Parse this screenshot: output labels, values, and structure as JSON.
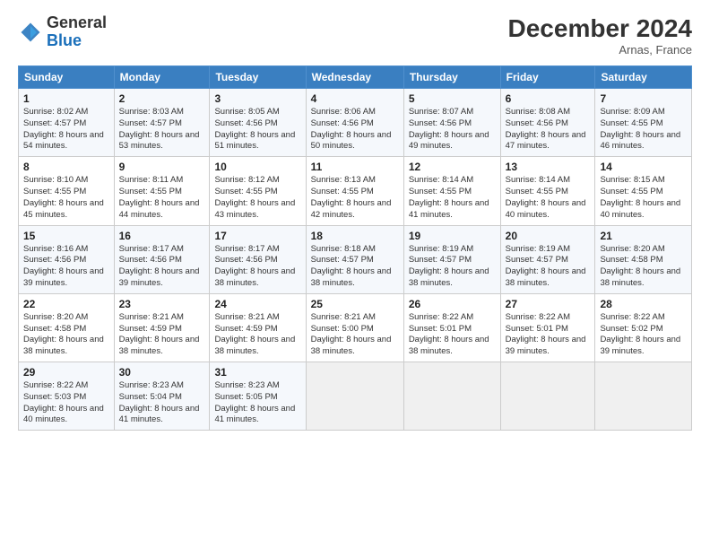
{
  "header": {
    "logo_general": "General",
    "logo_blue": "Blue",
    "month_title": "December 2024",
    "location": "Arnas, France"
  },
  "days_of_week": [
    "Sunday",
    "Monday",
    "Tuesday",
    "Wednesday",
    "Thursday",
    "Friday",
    "Saturday"
  ],
  "weeks": [
    [
      {
        "day": "1",
        "sunrise": "Sunrise: 8:02 AM",
        "sunset": "Sunset: 4:57 PM",
        "daylight": "Daylight: 8 hours and 54 minutes."
      },
      {
        "day": "2",
        "sunrise": "Sunrise: 8:03 AM",
        "sunset": "Sunset: 4:57 PM",
        "daylight": "Daylight: 8 hours and 53 minutes."
      },
      {
        "day": "3",
        "sunrise": "Sunrise: 8:05 AM",
        "sunset": "Sunset: 4:56 PM",
        "daylight": "Daylight: 8 hours and 51 minutes."
      },
      {
        "day": "4",
        "sunrise": "Sunrise: 8:06 AM",
        "sunset": "Sunset: 4:56 PM",
        "daylight": "Daylight: 8 hours and 50 minutes."
      },
      {
        "day": "5",
        "sunrise": "Sunrise: 8:07 AM",
        "sunset": "Sunset: 4:56 PM",
        "daylight": "Daylight: 8 hours and 49 minutes."
      },
      {
        "day": "6",
        "sunrise": "Sunrise: 8:08 AM",
        "sunset": "Sunset: 4:56 PM",
        "daylight": "Daylight: 8 hours and 47 minutes."
      },
      {
        "day": "7",
        "sunrise": "Sunrise: 8:09 AM",
        "sunset": "Sunset: 4:55 PM",
        "daylight": "Daylight: 8 hours and 46 minutes."
      }
    ],
    [
      {
        "day": "8",
        "sunrise": "Sunrise: 8:10 AM",
        "sunset": "Sunset: 4:55 PM",
        "daylight": "Daylight: 8 hours and 45 minutes."
      },
      {
        "day": "9",
        "sunrise": "Sunrise: 8:11 AM",
        "sunset": "Sunset: 4:55 PM",
        "daylight": "Daylight: 8 hours and 44 minutes."
      },
      {
        "day": "10",
        "sunrise": "Sunrise: 8:12 AM",
        "sunset": "Sunset: 4:55 PM",
        "daylight": "Daylight: 8 hours and 43 minutes."
      },
      {
        "day": "11",
        "sunrise": "Sunrise: 8:13 AM",
        "sunset": "Sunset: 4:55 PM",
        "daylight": "Daylight: 8 hours and 42 minutes."
      },
      {
        "day": "12",
        "sunrise": "Sunrise: 8:14 AM",
        "sunset": "Sunset: 4:55 PM",
        "daylight": "Daylight: 8 hours and 41 minutes."
      },
      {
        "day": "13",
        "sunrise": "Sunrise: 8:14 AM",
        "sunset": "Sunset: 4:55 PM",
        "daylight": "Daylight: 8 hours and 40 minutes."
      },
      {
        "day": "14",
        "sunrise": "Sunrise: 8:15 AM",
        "sunset": "Sunset: 4:55 PM",
        "daylight": "Daylight: 8 hours and 40 minutes."
      }
    ],
    [
      {
        "day": "15",
        "sunrise": "Sunrise: 8:16 AM",
        "sunset": "Sunset: 4:56 PM",
        "daylight": "Daylight: 8 hours and 39 minutes."
      },
      {
        "day": "16",
        "sunrise": "Sunrise: 8:17 AM",
        "sunset": "Sunset: 4:56 PM",
        "daylight": "Daylight: 8 hours and 39 minutes."
      },
      {
        "day": "17",
        "sunrise": "Sunrise: 8:17 AM",
        "sunset": "Sunset: 4:56 PM",
        "daylight": "Daylight: 8 hours and 38 minutes."
      },
      {
        "day": "18",
        "sunrise": "Sunrise: 8:18 AM",
        "sunset": "Sunset: 4:57 PM",
        "daylight": "Daylight: 8 hours and 38 minutes."
      },
      {
        "day": "19",
        "sunrise": "Sunrise: 8:19 AM",
        "sunset": "Sunset: 4:57 PM",
        "daylight": "Daylight: 8 hours and 38 minutes."
      },
      {
        "day": "20",
        "sunrise": "Sunrise: 8:19 AM",
        "sunset": "Sunset: 4:57 PM",
        "daylight": "Daylight: 8 hours and 38 minutes."
      },
      {
        "day": "21",
        "sunrise": "Sunrise: 8:20 AM",
        "sunset": "Sunset: 4:58 PM",
        "daylight": "Daylight: 8 hours and 38 minutes."
      }
    ],
    [
      {
        "day": "22",
        "sunrise": "Sunrise: 8:20 AM",
        "sunset": "Sunset: 4:58 PM",
        "daylight": "Daylight: 8 hours and 38 minutes."
      },
      {
        "day": "23",
        "sunrise": "Sunrise: 8:21 AM",
        "sunset": "Sunset: 4:59 PM",
        "daylight": "Daylight: 8 hours and 38 minutes."
      },
      {
        "day": "24",
        "sunrise": "Sunrise: 8:21 AM",
        "sunset": "Sunset: 4:59 PM",
        "daylight": "Daylight: 8 hours and 38 minutes."
      },
      {
        "day": "25",
        "sunrise": "Sunrise: 8:21 AM",
        "sunset": "Sunset: 5:00 PM",
        "daylight": "Daylight: 8 hours and 38 minutes."
      },
      {
        "day": "26",
        "sunrise": "Sunrise: 8:22 AM",
        "sunset": "Sunset: 5:01 PM",
        "daylight": "Daylight: 8 hours and 38 minutes."
      },
      {
        "day": "27",
        "sunrise": "Sunrise: 8:22 AM",
        "sunset": "Sunset: 5:01 PM",
        "daylight": "Daylight: 8 hours and 39 minutes."
      },
      {
        "day": "28",
        "sunrise": "Sunrise: 8:22 AM",
        "sunset": "Sunset: 5:02 PM",
        "daylight": "Daylight: 8 hours and 39 minutes."
      }
    ],
    [
      {
        "day": "29",
        "sunrise": "Sunrise: 8:22 AM",
        "sunset": "Sunset: 5:03 PM",
        "daylight": "Daylight: 8 hours and 40 minutes."
      },
      {
        "day": "30",
        "sunrise": "Sunrise: 8:23 AM",
        "sunset": "Sunset: 5:04 PM",
        "daylight": "Daylight: 8 hours and 41 minutes."
      },
      {
        "day": "31",
        "sunrise": "Sunrise: 8:23 AM",
        "sunset": "Sunset: 5:05 PM",
        "daylight": "Daylight: 8 hours and 41 minutes."
      },
      null,
      null,
      null,
      null
    ]
  ]
}
